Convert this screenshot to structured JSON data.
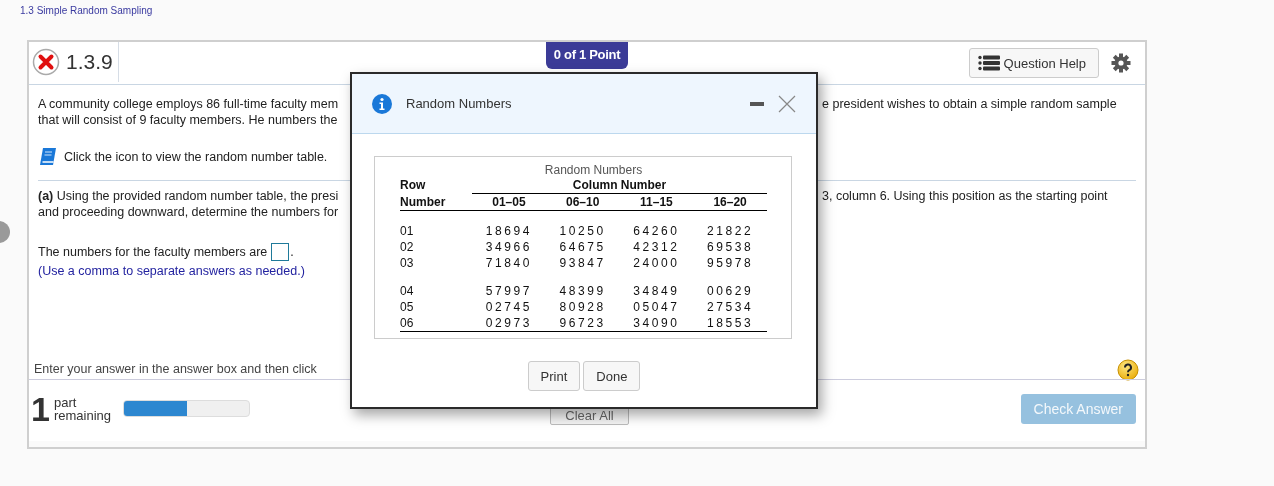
{
  "breadcrumb": "1.3 Simple Random Sampling",
  "question": {
    "correct": false,
    "number": "1.3.9",
    "points": "0 of 1 Point"
  },
  "question_help": "Question Help",
  "intro": {
    "left": [
      "A community college employs 86 full-time faculty mem",
      "that will consist of 9 faculty members. He numbers the"
    ],
    "right": [
      "e president wishes to obtain a simple random sample"
    ]
  },
  "table_link": "Click the icon to view the random number table.",
  "part_a": {
    "left": [
      "**(a)** Using the provided random number table, the presi",
      "and proceeding downward, determine the numbers for"
    ],
    "right": [
      "3, column 6. Using this position as the starting point"
    ]
  },
  "answer": {
    "prompt": "The numbers for the faculty members are",
    "suffix": ".",
    "hint": "(Use a comma to separate answers as needed.)"
  },
  "instruction": "Enter your answer in the answer box and then click",
  "progress": {
    "count": "1",
    "label": [
      "part",
      "remaining"
    ],
    "level": 0.5
  },
  "clear_all": "Clear All",
  "check_answer": {
    "label": "Check Answer",
    "disabled": true
  },
  "dialog": {
    "title": "Random Numbers",
    "table": {
      "caption": "Random Numbers",
      "row_header": [
        "Row",
        "Number"
      ],
      "column_group": "Column Number",
      "columns": [
        "01–05",
        "06–10",
        "11–15",
        "16–20"
      ],
      "groups": [
        [
          {
            "row": "01",
            "values": [
              "18694",
              "10250",
              "64260",
              "21822"
            ]
          },
          {
            "row": "02",
            "values": [
              "34966",
              "64675",
              "42312",
              "69538"
            ]
          },
          {
            "row": "03",
            "values": [
              "71840",
              "93847",
              "24000",
              "95978"
            ]
          }
        ],
        [
          {
            "row": "04",
            "values": [
              "57997",
              "48399",
              "34849",
              "00629"
            ]
          },
          {
            "row": "05",
            "values": [
              "02745",
              "80928",
              "05047",
              "27534"
            ]
          },
          {
            "row": "06",
            "values": [
              "02973",
              "96723",
              "34090",
              "18553"
            ]
          }
        ]
      ]
    },
    "buttons": [
      "Print",
      "Done"
    ]
  }
}
